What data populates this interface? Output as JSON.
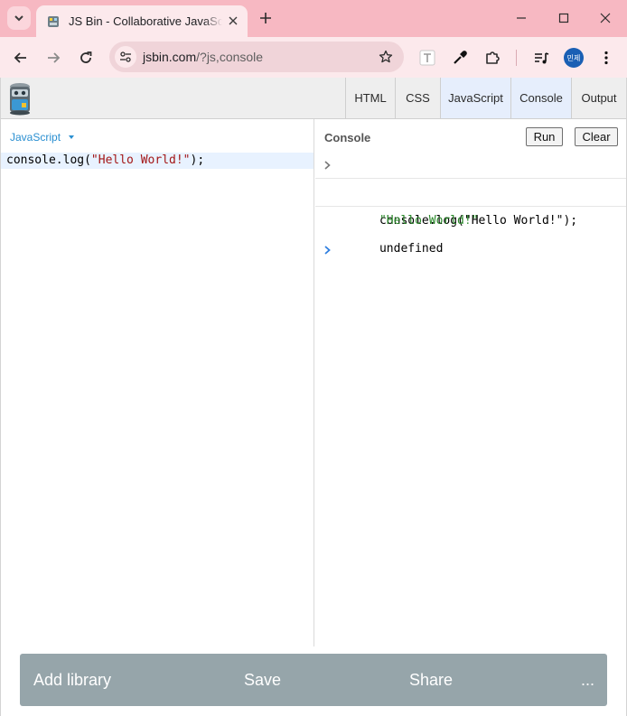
{
  "browser": {
    "tab_title": "JS Bin - Collaborative JavaScript",
    "url_host": "jsbin.com",
    "url_rest": "/?js,console",
    "profile_label": "민제",
    "colors": {
      "frame": "#f7b8c2",
      "toolbar": "#fce9ec",
      "omnibox": "#f0d4d9"
    }
  },
  "jsbin": {
    "panel_tabs": [
      "HTML",
      "CSS",
      "JavaScript",
      "Console",
      "Output"
    ],
    "active_tabs": [
      "JavaScript",
      "Console"
    ],
    "editor": {
      "language": "JavaScript",
      "code_prefix": "console.log(",
      "code_string": "\"Hello World!\"",
      "code_suffix": ");"
    },
    "console": {
      "title": "Console",
      "run_label": "Run",
      "clear_label": "Clear",
      "entries": [
        {
          "kind": "input",
          "text": "console.log(\"Hello World!\");"
        },
        {
          "kind": "output-string",
          "text": "\"Hello World!\""
        },
        {
          "kind": "output",
          "text": "undefined"
        }
      ]
    },
    "bottom_bar": {
      "add_library": "Add library",
      "save": "Save",
      "share": "Share",
      "more": "..."
    }
  }
}
